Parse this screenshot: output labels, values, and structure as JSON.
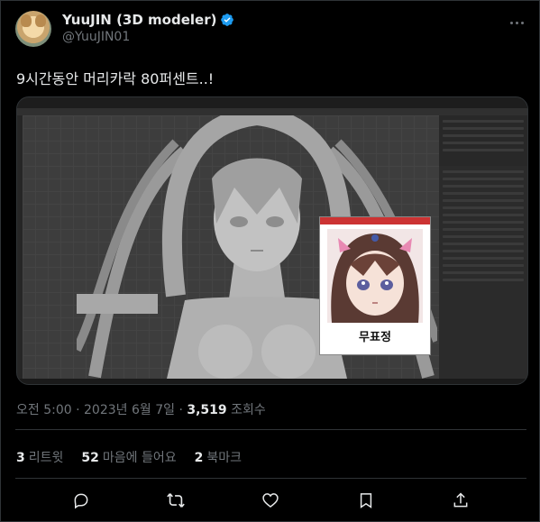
{
  "author": {
    "display_name": "YuuJIN (3D modeler)",
    "handle": "@YuuJIN01",
    "verified": true,
    "verified_color": "#1d9bf0"
  },
  "tweet": {
    "text": "9시간동안 머리카락 80퍼센트..!",
    "time": "오전 5:00",
    "date": "2023년 6월 7일",
    "views": "3,519",
    "views_label": "조회수"
  },
  "media": {
    "reference_label": "무표정"
  },
  "engagement": {
    "retweets": "3",
    "retweets_label": "리트윗",
    "likes": "52",
    "likes_label": "마음에 들어요",
    "bookmarks": "2",
    "bookmarks_label": "북마크"
  },
  "icons": {
    "more": "more-icon",
    "reply": "reply-icon",
    "retweet": "retweet-icon",
    "like": "heart-icon",
    "bookmark": "bookmark-icon",
    "share": "share-icon"
  },
  "colors": {
    "background": "#000000",
    "text_primary": "#e7e9ea",
    "text_secondary": "#71767b",
    "border": "#2f3336"
  }
}
